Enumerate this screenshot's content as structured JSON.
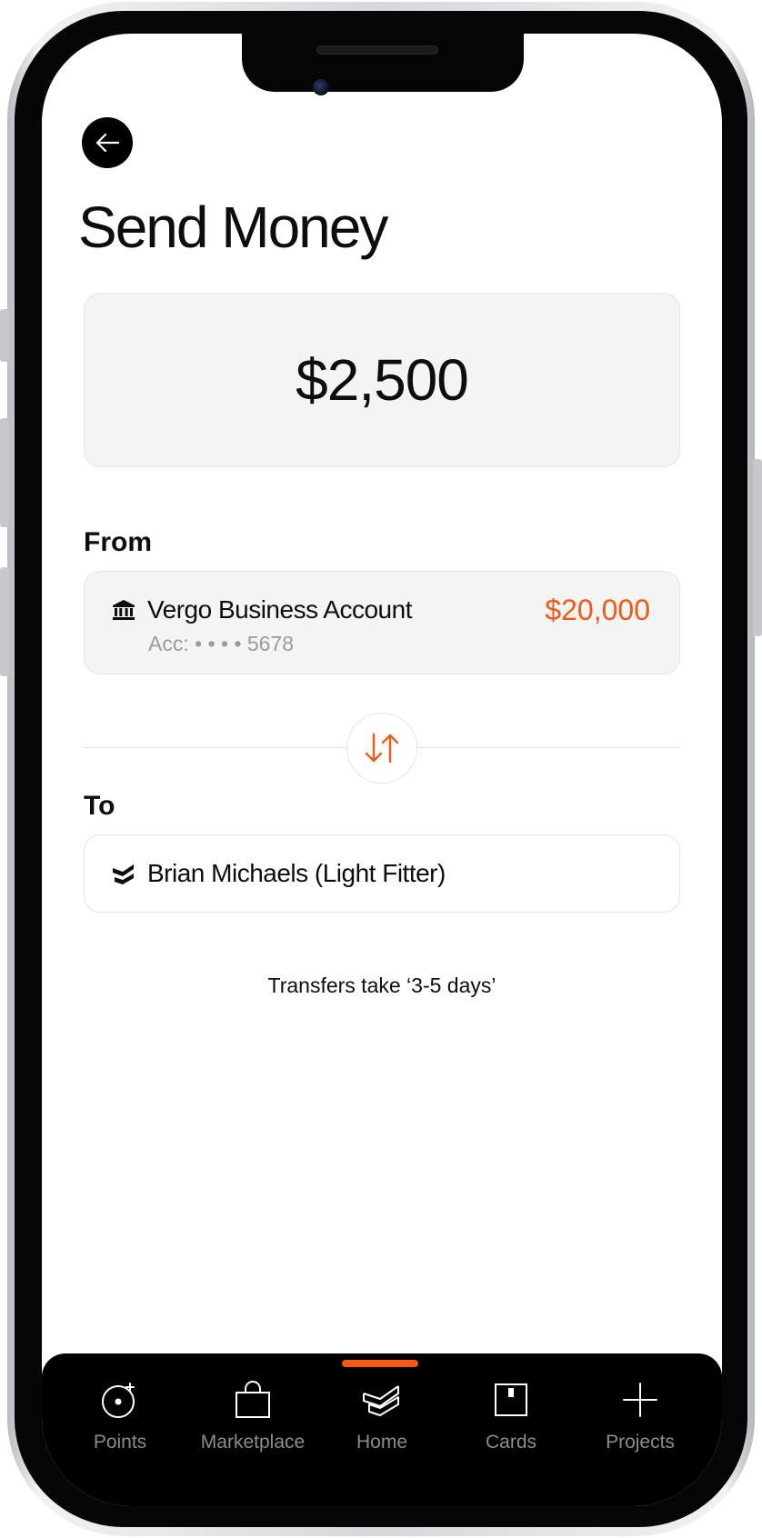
{
  "header": {
    "back_icon": "arrow-left-icon",
    "title": "Send Money"
  },
  "amount": {
    "value": "$2,500"
  },
  "from": {
    "label": "From",
    "icon": "bank-icon",
    "account_name": "Vergo Business Account",
    "account_number": "Acc: • • • • 5678",
    "balance": "$20,000"
  },
  "swap": {
    "icon": "swap-arrows-icon"
  },
  "to": {
    "label": "To",
    "icon": "vergo-logo-icon",
    "payee_name": "Brian Michaels (Light Fitter)"
  },
  "note": "Transfers take ‘3-5 days’",
  "nav": {
    "active": "Home",
    "items": [
      {
        "label": "Points",
        "icon": "points-icon"
      },
      {
        "label": "Marketplace",
        "icon": "shopping-bag-icon"
      },
      {
        "label": "Home",
        "icon": "home-logo-icon"
      },
      {
        "label": "Cards",
        "icon": "card-icon"
      },
      {
        "label": "Projects",
        "icon": "plus-icon"
      }
    ]
  },
  "colors": {
    "accent": "#f05a16",
    "text": "#0d0d0d",
    "muted": "#9a9a9a",
    "card_bg": "#f4f4f4",
    "nav_bg": "#000000"
  }
}
